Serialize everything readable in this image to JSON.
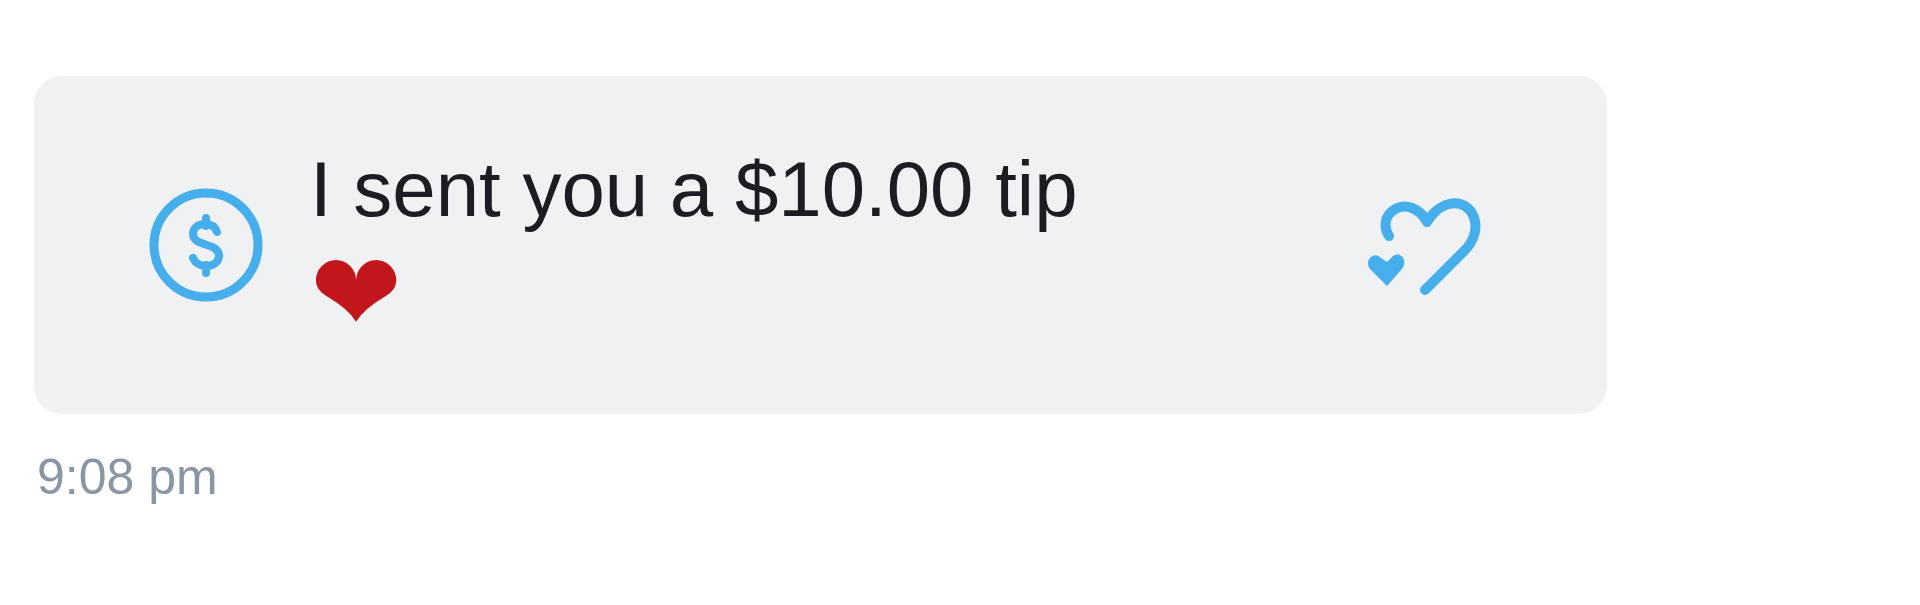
{
  "message": {
    "text": "I sent you a $10.00 tip",
    "emoji": "❤",
    "time": "9:08 pm"
  }
}
